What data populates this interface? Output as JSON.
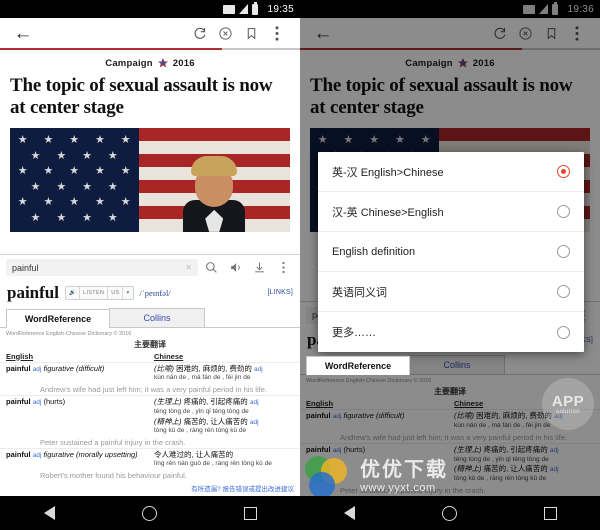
{
  "left": {
    "status": {
      "time": "19:35"
    },
    "toolbar": {
      "back": "back-arrow",
      "refresh": "refresh",
      "close": "close",
      "bookmark": "bookmark",
      "menu": "more"
    },
    "article": {
      "kicker_pre": "Campaign",
      "kicker_post": "2016",
      "headline": "The topic of sexual assault is now at center stage"
    },
    "dictionary": {
      "search_value": "painful",
      "search_placeholder": "painful",
      "word": "painful",
      "listen_label": "LISTEN",
      "region": "US",
      "phonetic": "/ˈpeɪnfəl/",
      "links_label": "[LINKS]",
      "tabs": [
        {
          "label": "WordReference",
          "active": true
        },
        {
          "label": "Collins",
          "active": false
        }
      ],
      "copyright": "WordReference English-Chinese Dictionary © 2016",
      "section_title": "主要翻译",
      "col_english": "English",
      "col_chinese": "Chinese",
      "entries": [
        {
          "headword": "painful",
          "pos": "adj",
          "sense": "figurative (difficult)",
          "defs": [
            {
              "marker": "(比喻)",
              "cn": "困难的, 麻烦的, 费劲的",
              "cn_pos": "adj",
              "pinyin": "kùn nán de , má fán de , fèi jìn de"
            }
          ],
          "example": "Andrew's wife had just left him; it was a very painful period in his life."
        },
        {
          "headword": "painful",
          "pos": "adj",
          "sense": "(hurts)",
          "defs": [
            {
              "marker": "(生理上)",
              "cn": "疼痛的, 引起疼痛的",
              "cn_pos": "adj",
              "pinyin": "téng tòng de , yǐn qǐ téng tòng de"
            },
            {
              "marker": "(精神上)",
              "cn": "痛苦的, 让人痛苦的",
              "cn_pos": "adj",
              "pinyin": "tòng kǔ de , ràng rén tòng kǔ de"
            }
          ],
          "example": "Peter sustained a painful injury in the crash."
        },
        {
          "headword": "painful",
          "pos": "adj",
          "sense": "figurative (morally upsetting)",
          "defs": [
            {
              "marker": "",
              "cn": "令人难过的, 让人痛苦的",
              "cn_pos": "",
              "pinyin": "lìng rén nán guò de , ràng rén tòng kǔ de"
            }
          ],
          "example": "Robert's mother found his behaviour painful."
        }
      ],
      "report_link": "有所遗漏? 报告错误或提出改进建议"
    }
  },
  "right": {
    "status": {
      "time": "19:36"
    },
    "dialog": {
      "options": [
        {
          "label": "英-汉 English>Chinese",
          "selected": true
        },
        {
          "label": "汉-英 Chinese>English",
          "selected": false
        },
        {
          "label": "English definition",
          "selected": false
        },
        {
          "label": "英语同义词",
          "selected": false
        },
        {
          "label": "更多……",
          "selected": false
        }
      ]
    },
    "watermarks": {
      "app_line1": "APP",
      "app_line2": "solution",
      "brand_cn": "优优下载",
      "brand_url": "www.yyxt.com"
    }
  },
  "colors": {
    "accent_red": "#b03030",
    "radio_selected": "#e8452c",
    "link_blue": "#3a6fd8"
  }
}
